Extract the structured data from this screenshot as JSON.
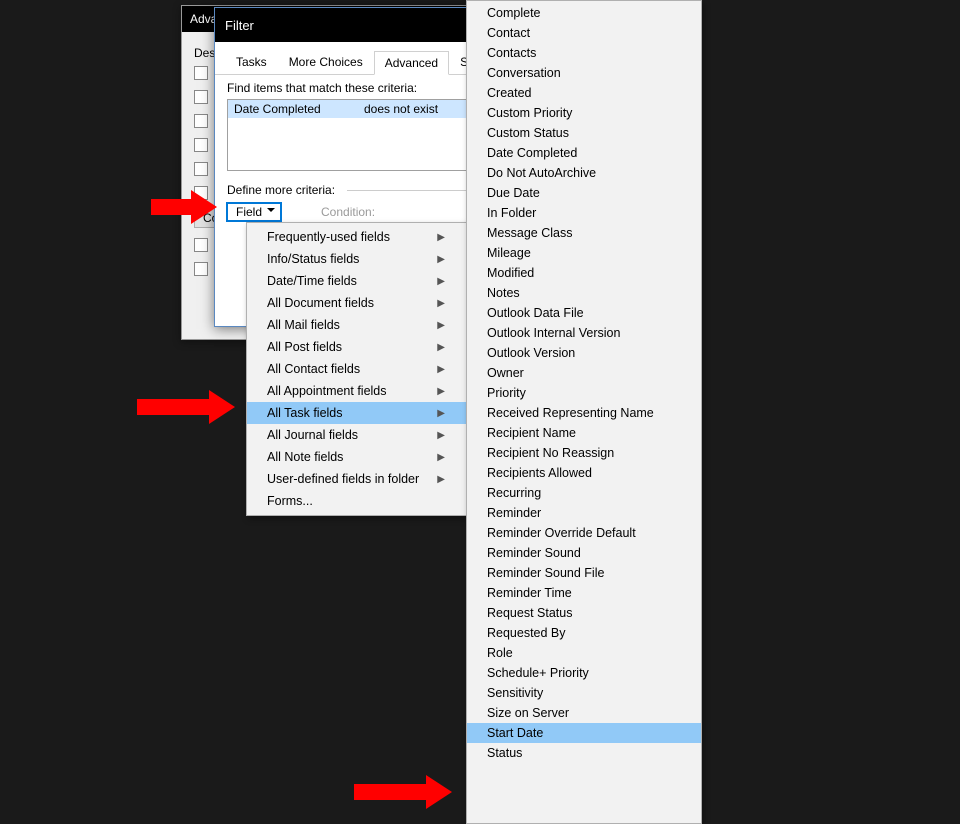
{
  "bgWindow": {
    "title": "Adva",
    "desLabel": "Des",
    "btn": "Co"
  },
  "filterWindow": {
    "title": "Filter",
    "tabs": [
      "Tasks",
      "More Choices",
      "Advanced",
      "SQL"
    ],
    "activeTabIndex": 2,
    "findLabel": "Find items that match these criteria:",
    "criteria": {
      "field": "Date Completed",
      "condition": "does not exist"
    },
    "defineLabel": "Define more criteria:",
    "fieldBtn": "Field",
    "conditionLabel": "Condition:"
  },
  "submenu": {
    "items": [
      "Frequently-used fields",
      "Info/Status fields",
      "Date/Time fields",
      "All Document fields",
      "All Mail fields",
      "All Post fields",
      "All Contact fields",
      "All Appointment fields",
      "All Task fields",
      "All Journal fields",
      "All Note fields",
      "User-defined fields in folder"
    ],
    "highlightIndex": 8,
    "lastItem": "Forms..."
  },
  "bigmenu": {
    "items": [
      "Complete",
      "Contact",
      "Contacts",
      "Conversation",
      "Created",
      "Custom Priority",
      "Custom Status",
      "Date Completed",
      "Do Not AutoArchive",
      "Due Date",
      "In Folder",
      "Message Class",
      "Mileage",
      "Modified",
      "Notes",
      "Outlook Data File",
      "Outlook Internal Version",
      "Outlook Version",
      "Owner",
      "Priority",
      "Received Representing Name",
      "Recipient Name",
      "Recipient No Reassign",
      "Recipients Allowed",
      "Recurring",
      "Reminder",
      "Reminder Override Default",
      "Reminder Sound",
      "Reminder Sound File",
      "Reminder Time",
      "Request Status",
      "Requested By",
      "Role",
      "Schedule+ Priority",
      "Sensitivity",
      "Size on Server",
      "Start Date",
      "Status"
    ],
    "highlightIndex": 36
  }
}
